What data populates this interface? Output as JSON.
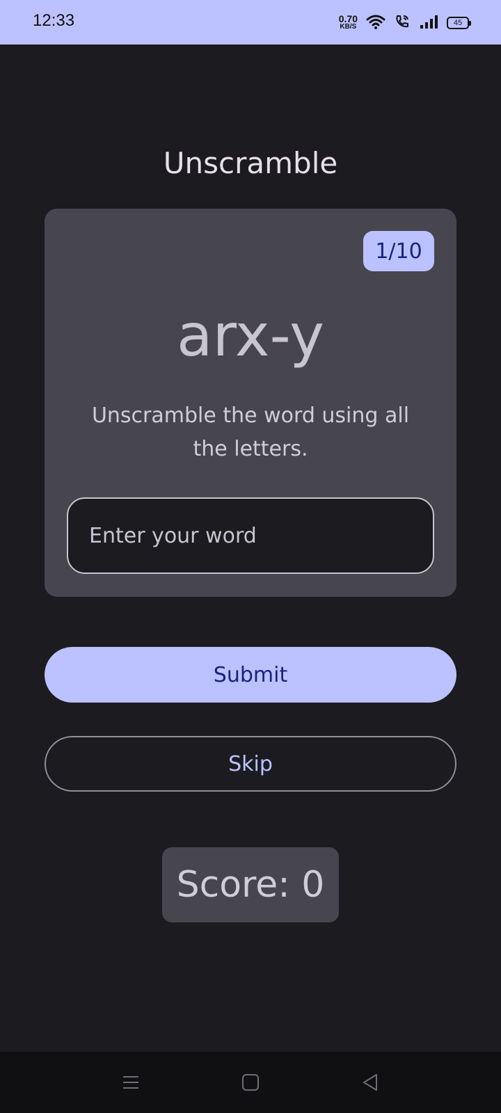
{
  "status_bar": {
    "time": "12:33",
    "net_speed_value": "0.70",
    "net_speed_unit": "KB/S",
    "battery": "45"
  },
  "app": {
    "title": "Unscramble"
  },
  "card": {
    "counter": "1/10",
    "scrambled_word": "arx-y",
    "instructions": "Unscramble the word using all the letters.",
    "input": {
      "placeholder": "Enter your word",
      "value": ""
    }
  },
  "actions": {
    "submit_label": "Submit",
    "skip_label": "Skip"
  },
  "score": {
    "label": "Score: 0"
  },
  "nav_bar": {
    "icons": [
      "menu-icon",
      "home-icon",
      "back-icon"
    ]
  },
  "colors": {
    "background": "#1c1b20",
    "surface": "#47464f",
    "primary": "#bcc2ff",
    "on_primary": "#1a237e"
  }
}
